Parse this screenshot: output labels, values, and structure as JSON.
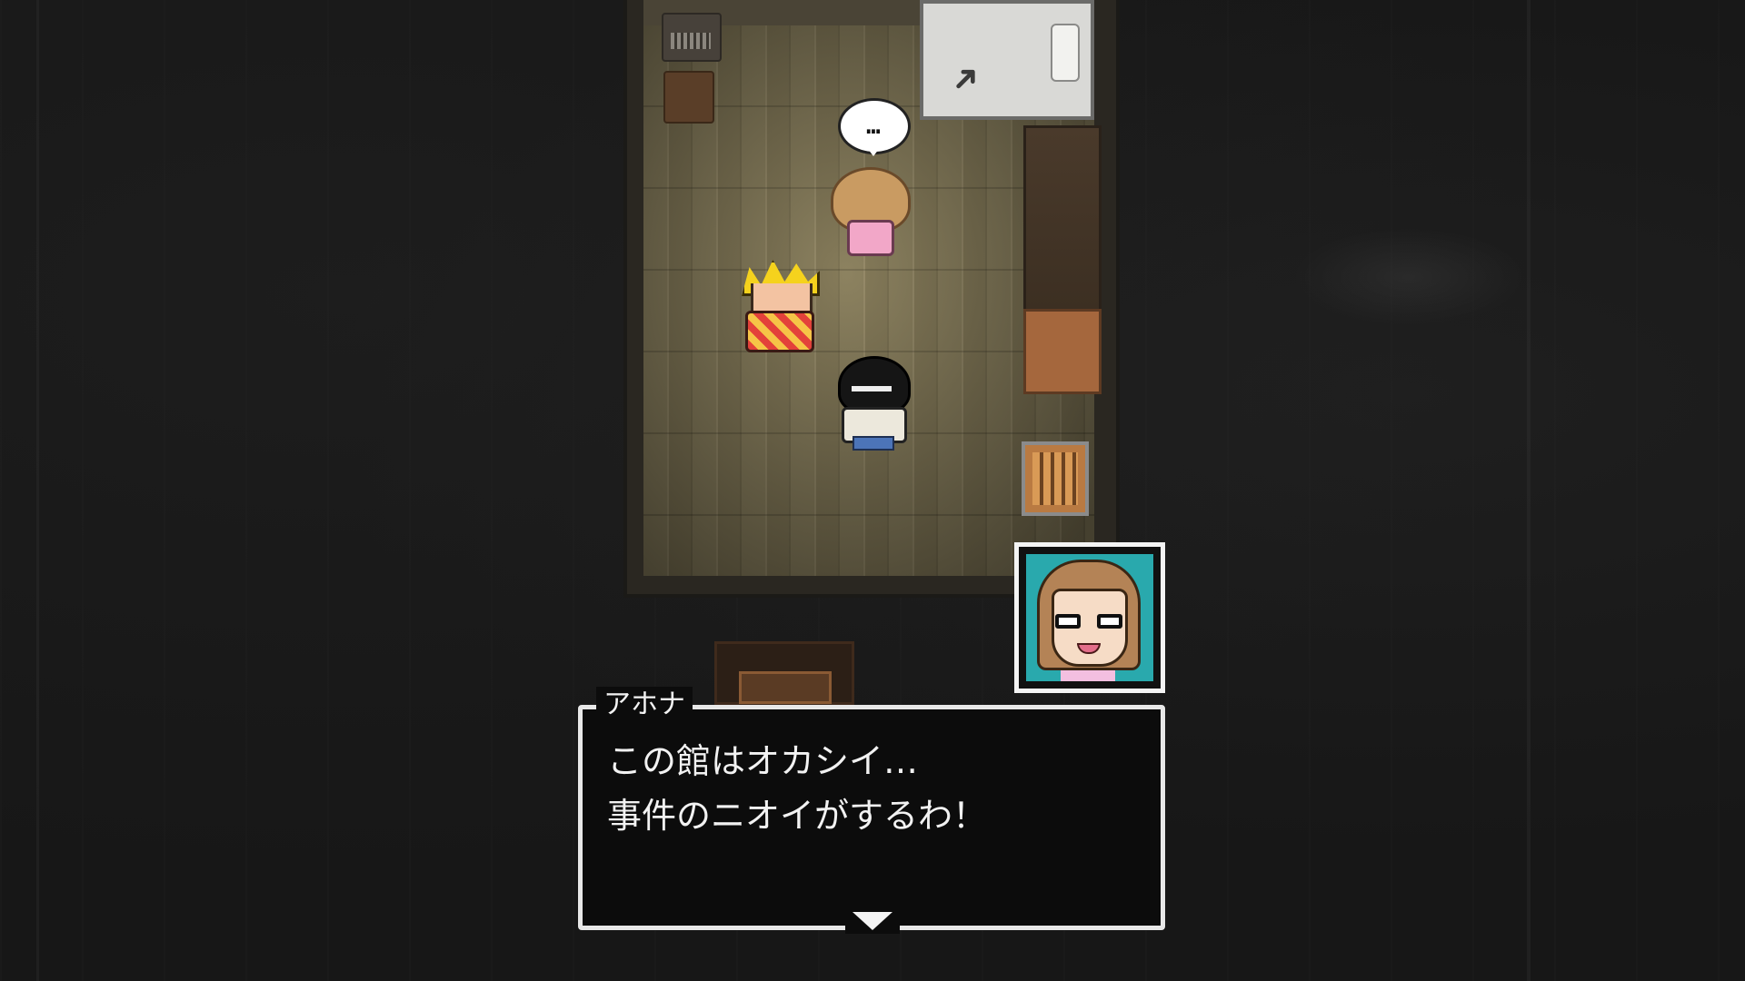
{
  "scene": {
    "speech_bubble_text": "…",
    "characters": [
      {
        "name": "girl-npc",
        "hair_color": "#c99b62",
        "outfit_color": "#f2a7c8"
      },
      {
        "name": "blond-npc",
        "hair_color": "#f5d21d",
        "outfit_color": "#e3413a"
      },
      {
        "name": "player-boy",
        "hair_color": "#151515",
        "outfit_color": "#ece8dc"
      }
    ],
    "floor_color": "#7d7456"
  },
  "portrait": {
    "background_color": "#29a9ad",
    "hair_color": "#b48356",
    "icon": "speaker-portrait"
  },
  "dialog": {
    "speaker": "アホナ",
    "lines": [
      "この館はオカシイ…",
      "事件のニオイがするわ！"
    ],
    "advance_icon": "triangle-down-icon"
  },
  "icons": {
    "bed_marker": "cursor-arrow-icon"
  }
}
